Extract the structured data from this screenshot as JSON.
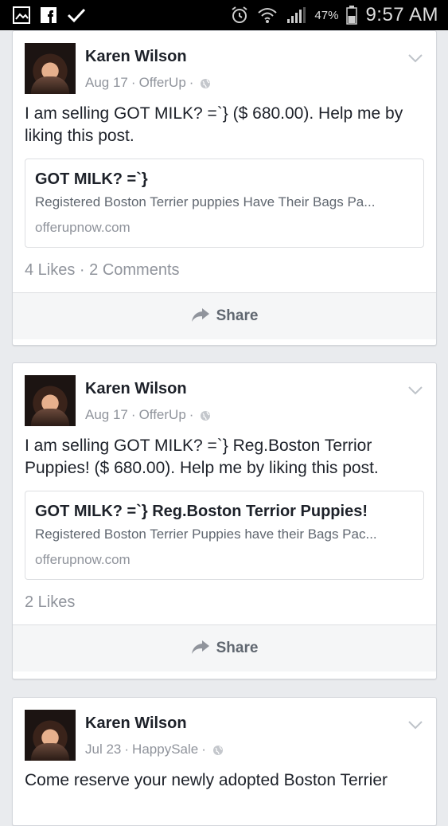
{
  "status_bar": {
    "battery_percent": "47%",
    "time": "9:57 AM",
    "left_icons": [
      "gallery-icon",
      "facebook-icon",
      "check-icon"
    ],
    "right_icons": [
      "alarm-icon",
      "wifi-icon",
      "signal-icon",
      "battery-icon"
    ]
  },
  "posts": [
    {
      "author": "Karen Wilson",
      "date": "Aug 17",
      "app": "OfferUp",
      "text": "I am selling GOT MILK? =`} ($ 680.00). Help me by liking this post.",
      "link": {
        "title": "GOT MILK? =`}",
        "description": "Registered Boston Terrier puppies Have Their Bags Pa...",
        "domain": "offerupnow.com"
      },
      "stats": "4 Likes · 2 Comments",
      "share_label": "Share"
    },
    {
      "author": "Karen Wilson",
      "date": "Aug 17",
      "app": "OfferUp",
      "text": "I am selling GOT MILK? =`} Reg.Boston Terrior Puppies! ($ 680.00). Help me by liking this post.",
      "link": {
        "title": "GOT MILK? =`} Reg.Boston Terrior Puppies!",
        "description": "Registered Boston Terrier Puppies have their Bags Pac...",
        "domain": "offerupnow.com"
      },
      "stats": "2 Likes",
      "share_label": "Share"
    },
    {
      "author": "Karen Wilson",
      "date": "Jul 23",
      "app": "HappySale",
      "text": "Come reserve your newly adopted Boston Terrier"
    }
  ],
  "colors": {
    "status_bar_bg": "#000000",
    "feed_bg": "#e9ebee",
    "card_bg": "#ffffff",
    "text_primary": "#1d2129",
    "text_secondary": "#90949c"
  }
}
